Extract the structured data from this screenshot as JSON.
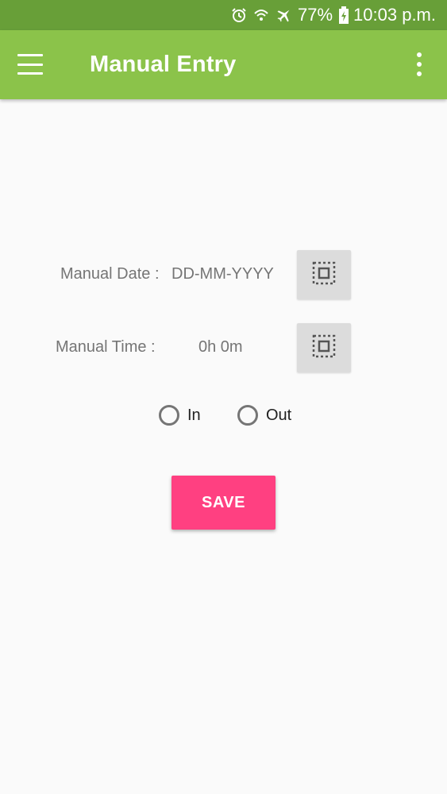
{
  "status_bar": {
    "battery": "77%",
    "time": "10:03 p.m.",
    "icons": [
      "alarm-icon",
      "wifi-icon",
      "airplane-icon",
      "battery-icon"
    ]
  },
  "app_bar": {
    "title": "Manual Entry",
    "color": "#8bc34a",
    "icons": [
      "hamburger-menu-icon",
      "overflow-menu-icon"
    ]
  },
  "form": {
    "date_label": "Manual Date :",
    "date_value": "DD-MM-YYYY",
    "time_label": "Manual Time :",
    "time_value": "0h 0m",
    "picker_icon": "select-all-icon",
    "radio_in": "In",
    "radio_out": "Out",
    "save_label": "SAVE",
    "save_color": "#ff4081"
  }
}
